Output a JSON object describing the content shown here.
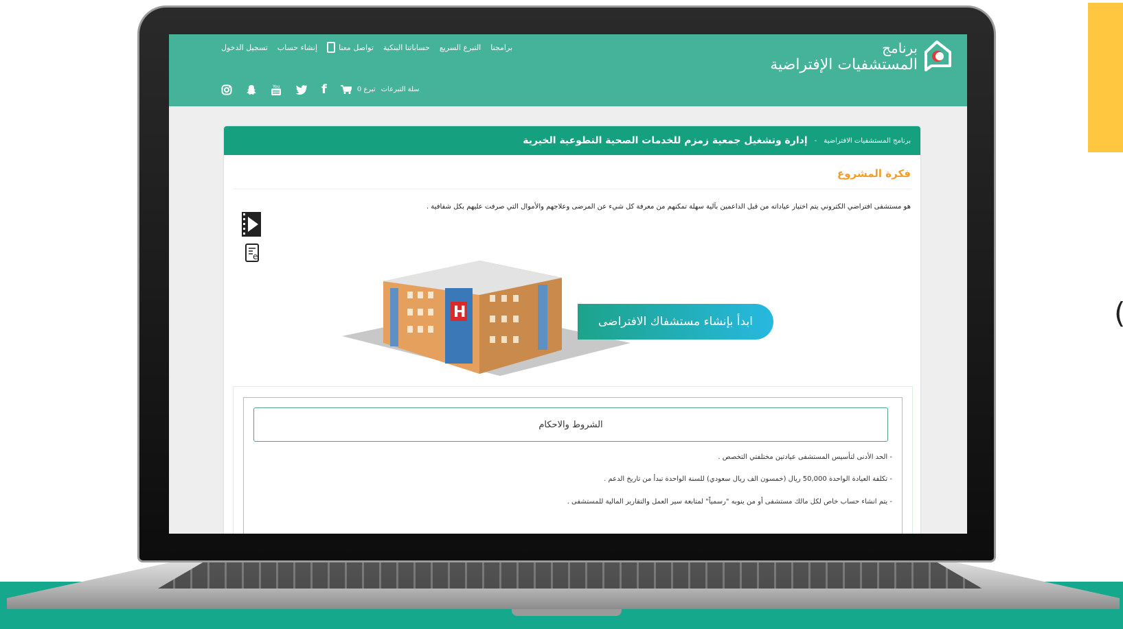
{
  "header": {
    "logo_line1": "برنامج",
    "logo_line2": "المستشفيات الإفتراضية",
    "nav": [
      "برامجنا",
      "التبرع السريع",
      "حساباتنا البنكية",
      "تواصل معنا",
      "إنشاء حساب",
      "تسجيل الدخول"
    ],
    "cart_label": "سلة التبرعات",
    "cart_count": "0 تبرع",
    "social_icons": [
      "facebook-icon",
      "twitter-icon",
      "youtube-icon",
      "snapchat-icon",
      "instagram-icon"
    ]
  },
  "breadcrumb": {
    "parent": "برنامج المستشفيات الافتراضية",
    "separator": "-",
    "title": "إدارة وتشغيل جمعية زمزم للخدمات الصحية التطوعية الخيرية"
  },
  "section_title": "فكرة المشروع",
  "description": "هو مستشفى افتراضي الكتروني يتم اختيار عياداته من قبل الداعمين بآلية سهلة تمكنهم من معرفة كل شيء عن المرضى وعلاجهم والأموال التي صرفت عليهم بكل شفافية .",
  "cta_label": "ابدأ بإنشاء مستشفاك الافتراضى",
  "terms": {
    "title": "الشروط والاحكام",
    "items": [
      "- الحد الأدنى لتأسيس المستشفى عيادتين مختلفتي التخصص .",
      "- تكلفة العيادة الواحدة 50,000 ريال (خمسون الف ريال سعودي) للسنة الواحدة تبدأ من تاريخ الدعم .",
      "- يتم انشاء حساب خاص لكل مالك مستشفى أو من ينوبه \"رسمياً\" لمتابعة سير العمل والتقارير المالية للمستشفى ."
    ]
  },
  "colors": {
    "header_bg": "#45b39a",
    "card_header_bg": "#15a07f",
    "accent_orange": "#f39c2a",
    "cta_gradient": [
      "#1da38a",
      "#27b8e0"
    ],
    "page_accent_yellow": "#ffc640",
    "page_accent_green": "#15a88c"
  }
}
